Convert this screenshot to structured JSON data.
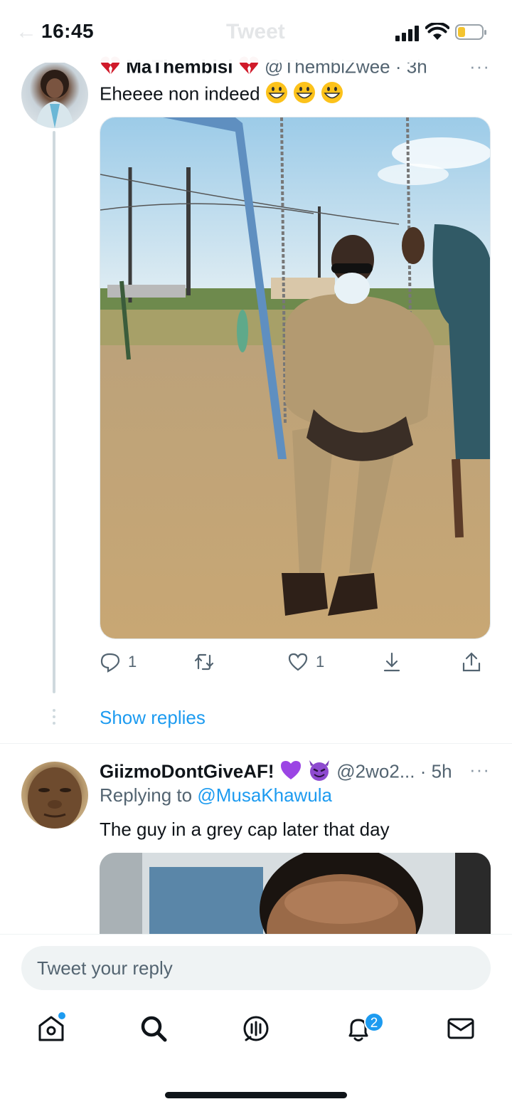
{
  "status_bar": {
    "time": "16:45",
    "ghost_title": "Tweet",
    "signal_icon": "cellular-signal-icon",
    "wifi_icon": "wifi-icon",
    "battery_icon": "battery-low-icon",
    "battery_level": 0.2
  },
  "tweet1": {
    "display_name": "MaThembisi",
    "name_emoji": "broken-heart-emoji",
    "handle": "@ThembiZwee",
    "time": "· 3h",
    "text": "Eheeee non indeed",
    "text_emojis": [
      "grinning-face-emoji",
      "grinning-face-emoji",
      "grinning-face-emoji"
    ],
    "image_description_icon": "photo-man-on-swing",
    "replies": "1",
    "retweets": "",
    "likes": "1",
    "more": "···"
  },
  "show_replies": "Show replies",
  "tweet2": {
    "display_name": "GiizmoDontGiveAF!",
    "name_emojis": [
      "purple-heart-emoji",
      "smiling-devil-emoji"
    ],
    "handle": "@2wo2...",
    "time": "· 5h",
    "replying_label": "Replying to",
    "replying_handle": "@MusaKhawula",
    "text": "The guy in a grey cap later that day",
    "more": "···"
  },
  "compose": {
    "placeholder": "Tweet your reply"
  },
  "tab_bar": {
    "items": [
      "home-icon",
      "search-icon",
      "spaces-icon",
      "notifications-icon",
      "messages-icon"
    ],
    "notification_count": "2"
  },
  "colors": {
    "accent": "#1d9bf0",
    "text": "#0f1419",
    "secondary": "#536471"
  }
}
